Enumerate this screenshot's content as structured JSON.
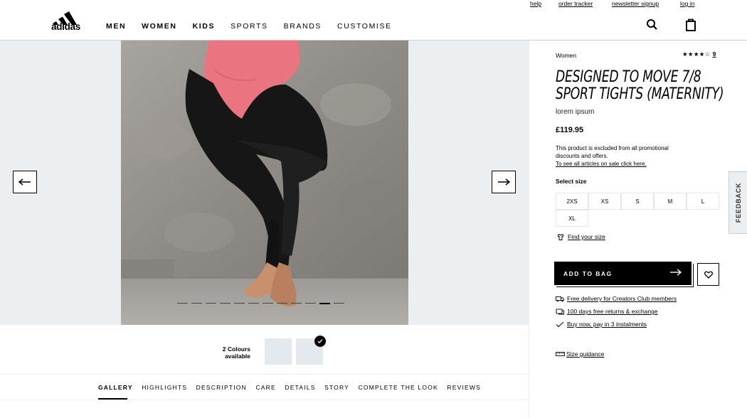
{
  "utility_nav": {
    "help": "help",
    "order_tracker": "order tracker",
    "newsletter": "newsletter signup",
    "login": "log in"
  },
  "brand": {
    "logo_text": "adidas"
  },
  "main_nav": {
    "men": "MEN",
    "women": "WOMEN",
    "kids": "KIDS",
    "sports": "SPORTS",
    "brands": "BRANDS",
    "customise": "CUSTOMISE"
  },
  "header_icons": [
    "search-icon",
    "shopping-bag-icon"
  ],
  "gallery": {
    "slide_count": 12,
    "active_slide": 10,
    "prev_icon": "arrow-left-icon",
    "next_icon": "arrow-right-icon"
  },
  "colours": {
    "label_line1": "2 Colours",
    "label_line2": "available",
    "selected_index": 1
  },
  "tabs": [
    "GALLERY",
    "HIGHLIGHTS",
    "DESCRIPTION",
    "CARE",
    "DETAILS",
    "STORY",
    "COMPLETE THE LOOK",
    "REVIEWS"
  ],
  "product": {
    "category": "Women",
    "stars": "★★★★☆",
    "review_count": "9",
    "title_line1": "DESIGNED TO MOVE 7/8",
    "title_line2": "SPORT TIGHTS (MATERNITY)",
    "subtitle": "lorem ipsum",
    "price": "£119.95",
    "promo_line1": "This product is excluded from all promotional",
    "promo_line2": "discounts and offers.",
    "promo_link": "To see all articles on sale click here.",
    "select_size": "Select size",
    "sizes": [
      "2XS",
      "XS",
      "S",
      "M",
      "L",
      "XL"
    ],
    "find_size": "Find your size",
    "add_to_bag": "ADD TO BAG",
    "perks": [
      "Free delivery for Creators Club members",
      "100 days free returns & exchange",
      "Buy now, pay in 3 instalments"
    ],
    "size_guidance": "Size guidance"
  },
  "feedback": "FEEDBACK",
  "colors": {
    "accent": "#000000",
    "gallery_bg": "#eceff1",
    "shirt": "#e9717c"
  }
}
